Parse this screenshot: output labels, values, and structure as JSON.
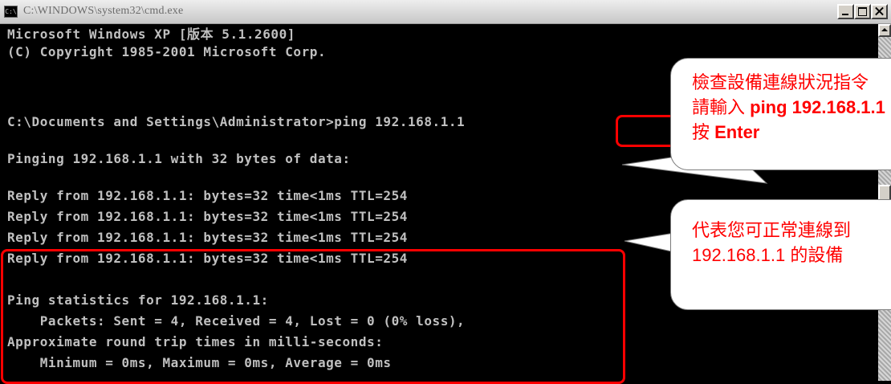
{
  "window": {
    "title": "C:\\WINDOWS\\system32\\cmd.exe",
    "icon_label": "C:\\",
    "buttons": [
      "minimize",
      "maximize",
      "close"
    ]
  },
  "console": {
    "lines": [
      "Microsoft Windows XP [版本 5.1.2600]",
      "(C) Copyright 1985-2001 Microsoft Corp.",
      "",
      "C:\\Documents and Settings\\Administrator>ping 192.168.1.1",
      "",
      "Pinging 192.168.1.1 with 32 bytes of data:",
      "",
      "Reply from 192.168.1.1: bytes=32 time<1ms TTL=254",
      "Reply from 192.168.1.1: bytes=32 time<1ms TTL=254",
      "Reply from 192.168.1.1: bytes=32 time<1ms TTL=254",
      "Reply from 192.168.1.1: bytes=32 time<1ms TTL=254",
      "",
      "Ping statistics for 192.168.1.1:",
      "    Packets: Sent = 4, Received = 4, Lost = 0 (0% loss),",
      "Approximate round trip times in milli-seconds:",
      "    Minimum = 0ms, Maximum = 0ms, Average = 0ms"
    ]
  },
  "callouts": {
    "command_hint": {
      "line1": "檢查設備連線狀況指令",
      "line2_prefix": "請輸入 ",
      "line2_bold": "ping 192.168.1.1",
      "line3_prefix": "按 ",
      "line3_bold": "Enter"
    },
    "reply_hint": {
      "line1": "代表您可正常連線到",
      "line2": "192.168.1.1 的設備"
    }
  },
  "colors": {
    "console_bg": "#000000",
    "console_text": "#c0c0c0",
    "highlight": "#ff0000",
    "callout_text": "#ff0000"
  }
}
